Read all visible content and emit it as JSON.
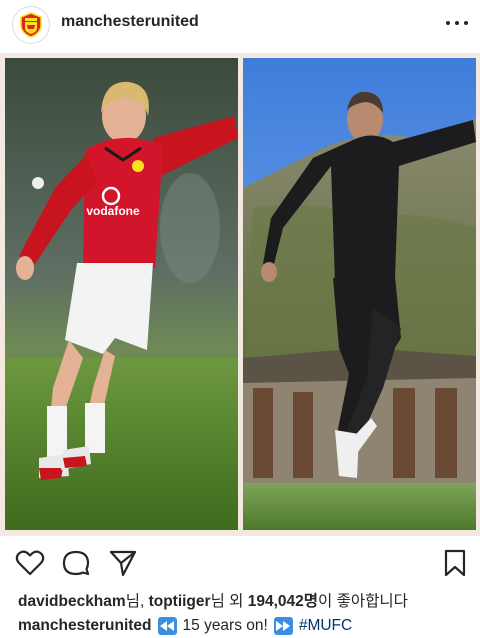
{
  "post": {
    "username": "manchesterunited",
    "avatar_icon": "manchester-united-crest-icon",
    "more_icon": "more-options-icon"
  },
  "photo": {
    "left_panel": {
      "shirt_text": "vodafone",
      "shirt_color": "#d2152a",
      "shorts_color": "#ffffff"
    },
    "right_panel": {
      "outfit_color": "#1c1c1e",
      "sky_color": "#4d8fe6"
    },
    "frame_color": "#f3e9e0"
  },
  "actions": {
    "like_icon": "heart-icon",
    "comment_icon": "comment-icon",
    "share_icon": "send-icon",
    "save_icon": "bookmark-icon"
  },
  "likes": {
    "user1": "davidbeckham",
    "sep1": "님, ",
    "user2": "toptiiger",
    "sep2": "님 외 ",
    "count": "194,042명",
    "suffix": "이 좋아합니다"
  },
  "caption": {
    "username": "manchesterunited",
    "rewind_emoji": "rewind-emoji",
    "text": "15 years on!",
    "forward_emoji": "fast-forward-emoji",
    "hashtag": "#MUFC"
  }
}
